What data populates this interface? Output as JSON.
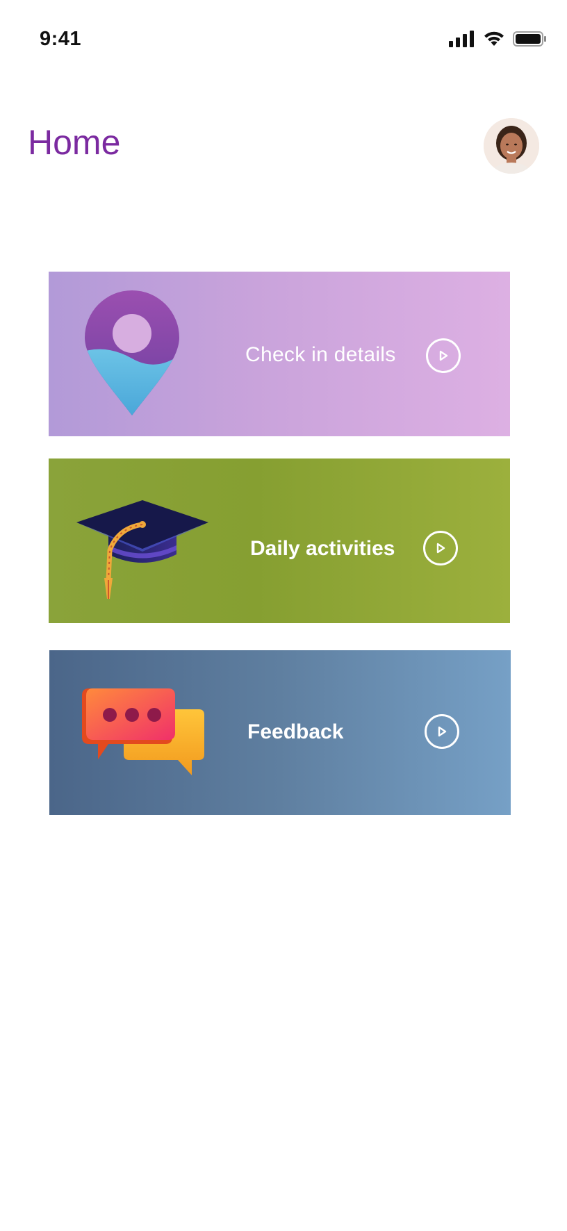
{
  "status_bar": {
    "time": "9:41",
    "icons": [
      "signal-icon",
      "wifi-icon",
      "battery-icon"
    ]
  },
  "header": {
    "title": "Home",
    "title_color": "#7b2aa0",
    "avatar_icon": "user-avatar"
  },
  "cards": [
    {
      "label": "Check in details",
      "icon": "location-pin-icon",
      "action_icon": "play-icon"
    },
    {
      "label": "Daily activities",
      "icon": "graduation-cap-icon",
      "action_icon": "play-icon"
    },
    {
      "label": "Feedback",
      "icon": "chat-bubbles-icon",
      "action_icon": "play-icon"
    }
  ],
  "colors": {
    "check_in_card": "#c9a3db",
    "daily_activities_card": "#8aa33a",
    "feedback_card": "#5f7fa0"
  }
}
